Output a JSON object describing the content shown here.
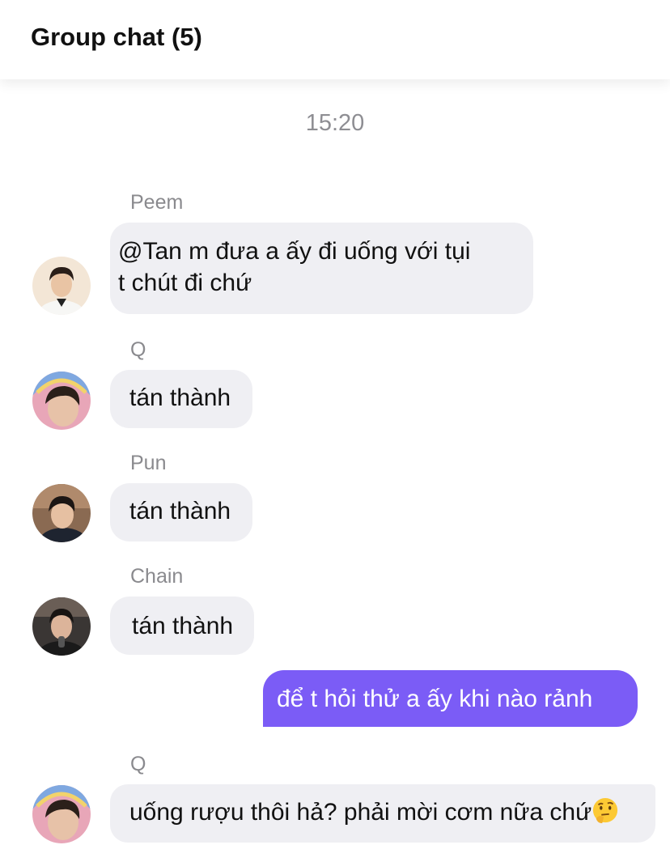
{
  "header": {
    "title": "Group chat (5)"
  },
  "timestamp": "15:20",
  "colors": {
    "outgoing_bubble": "#7b5cf6",
    "incoming_bubble": "#efeff3"
  },
  "messages": [
    {
      "sender": "Peem",
      "line1": "@Tan  m đưa a ấy đi uống với tụi",
      "line2": "t chút đi chứ"
    },
    {
      "sender": "Q",
      "text": "tán thành"
    },
    {
      "sender": "Pun",
      "text": "tán thành"
    },
    {
      "sender": "Chain",
      "text": "tán thành"
    },
    {
      "sender": "me",
      "text": "để t hỏi thử a ấy khi nào rảnh"
    },
    {
      "sender": "Q",
      "text": "uống rượu thôi hả? phải mời cơm nữa chứ",
      "emoji": "thinking-face-icon"
    }
  ]
}
